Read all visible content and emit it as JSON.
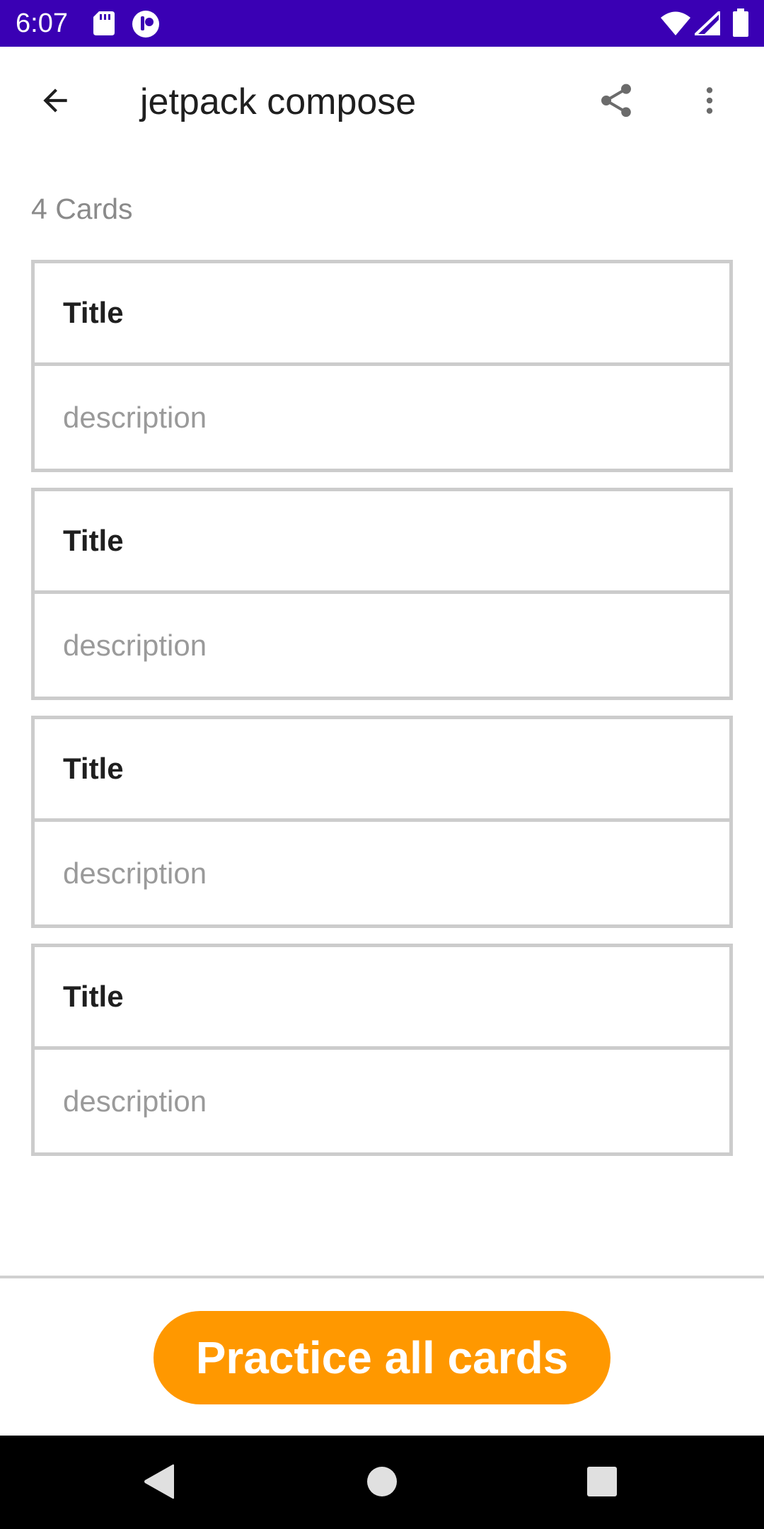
{
  "status_bar": {
    "time": "6:07",
    "icons": [
      "sd-card-icon",
      "app-notification-icon",
      "wifi-icon",
      "signal-icon",
      "battery-icon"
    ],
    "background": "#3a00b4"
  },
  "app_bar": {
    "title": "jetpack compose",
    "back_icon": "arrow-back-icon",
    "actions": [
      "share-icon",
      "more-vert-icon"
    ]
  },
  "deck": {
    "count_label": "4 Cards",
    "cards": [
      {
        "title": "Title",
        "description": "description"
      },
      {
        "title": "Title",
        "description": "description"
      },
      {
        "title": "Title",
        "description": "description"
      },
      {
        "title": "Title",
        "description": "description"
      }
    ]
  },
  "footer": {
    "practice_label": "Practice all cards",
    "accent": "#ff9800"
  },
  "nav_bar": {
    "buttons": [
      "back-triangle-icon",
      "home-circle-icon",
      "recents-square-icon"
    ]
  }
}
